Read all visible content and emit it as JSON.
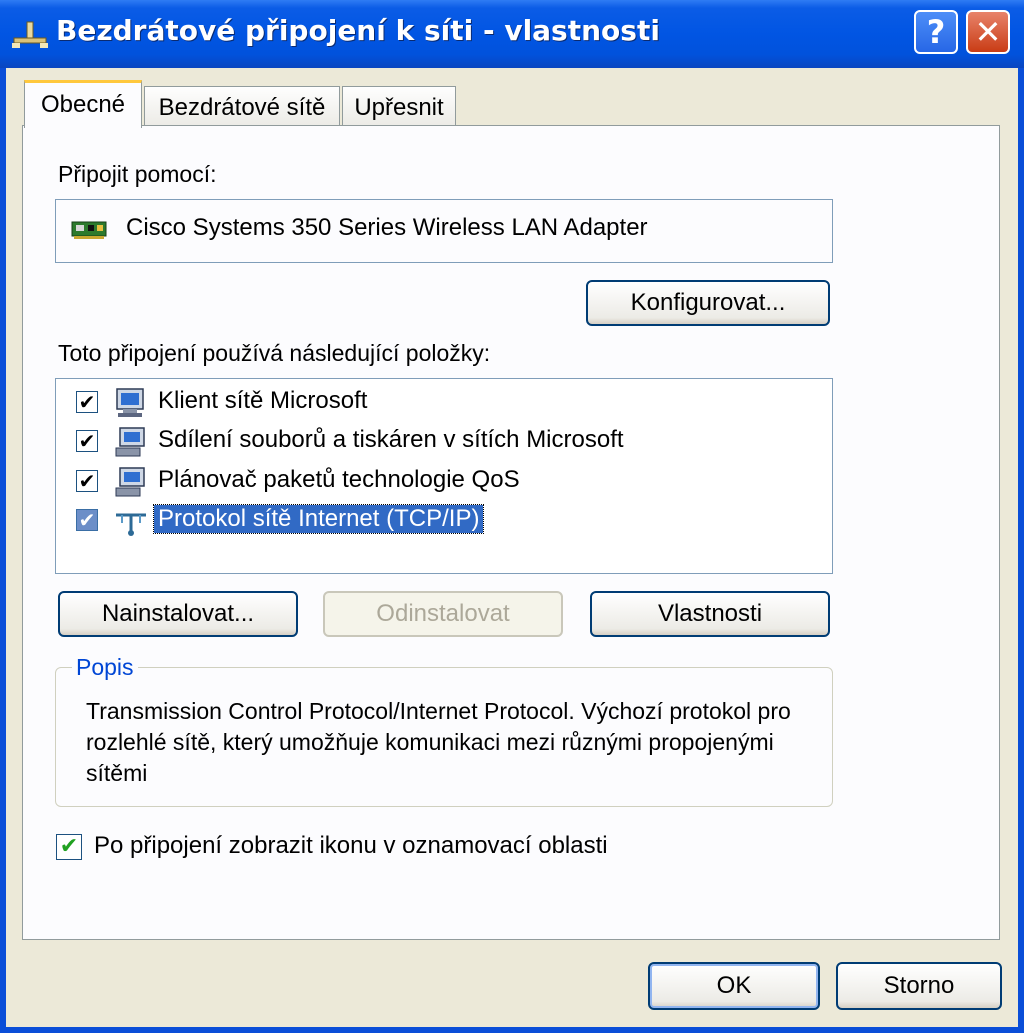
{
  "window": {
    "title": "Bezdrátové připojení k síti - vlastnosti",
    "help_glyph": "?",
    "close_glyph": "✕"
  },
  "tabs": [
    {
      "label": "Obecné",
      "active": true
    },
    {
      "label": "Bezdrátové sítě",
      "active": false
    },
    {
      "label": "Upřesnit",
      "active": false
    }
  ],
  "general": {
    "connect_using_label": "Připojit pomocí:",
    "adapter_name": "Cisco Systems 350 Series Wireless LAN Adapter",
    "configure_button": "Konfigurovat...",
    "items_label": "Toto připojení používá následující položky:",
    "items": [
      {
        "label": "Klient sítě Microsoft",
        "checked": true,
        "icon": "network-client-icon",
        "selected": false
      },
      {
        "label": "Sdílení souborů a tiskáren v sítích Microsoft",
        "checked": true,
        "icon": "file-printer-sharing-icon",
        "selected": false
      },
      {
        "label": "Plánovač paketů technologie QoS",
        "checked": true,
        "icon": "qos-scheduler-icon",
        "selected": false
      },
      {
        "label": "Protokol sítě Internet (TCP/IP)",
        "checked": true,
        "icon": "protocol-icon",
        "selected": true
      }
    ],
    "install_button": "Nainstalovat...",
    "uninstall_button": "Odinstalovat",
    "properties_button": "Vlastnosti",
    "description_group_title": "Popis",
    "description_text": "Transmission Control Protocol/Internet Protocol. Výchozí protokol pro rozlehlé sítě, který umožňuje komunikaci mezi různými propojenými sítěmi",
    "notify_checkbox_label": "Po připojení zobrazit ikonu v oznamovací oblasti",
    "notify_checked": true,
    "check_glyph": "✔"
  },
  "footer": {
    "ok_button": "OK",
    "cancel_button": "Storno"
  },
  "colors": {
    "titlebar_blue": "#0155e3",
    "selection_blue": "#316ac5",
    "dialog_bg": "#ece9d8",
    "tab_highlight": "#ffc83c",
    "groupbox_title": "#0046d5"
  }
}
